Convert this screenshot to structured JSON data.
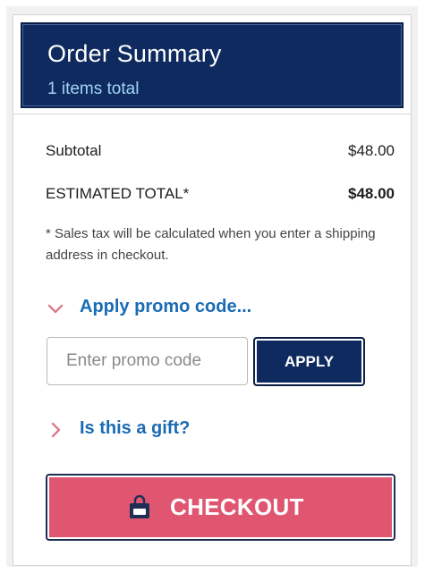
{
  "summary": {
    "title": "Order Summary",
    "items_total": "1 items total"
  },
  "lines": {
    "subtotal_label": "Subtotal",
    "subtotal_value": "$48.00",
    "estimated_total_label": "ESTIMATED TOTAL*",
    "estimated_total_value": "$48.00"
  },
  "note": "* Sales tax will be calculated when you enter a shipping address in checkout.",
  "promo": {
    "toggle_label": "Apply promo code...",
    "input_placeholder": "Enter promo code",
    "input_value": "",
    "apply_label": "APPLY"
  },
  "gift": {
    "toggle_label": "Is this a gift?"
  },
  "checkout": {
    "label": "CHECKOUT"
  },
  "icons": {
    "promo_toggle": "chevron-down-icon",
    "gift_toggle": "chevron-right-icon",
    "checkout": "shopping-bag-icon"
  },
  "colors": {
    "header_bg": "#0f2a5f",
    "header_subtitle": "#9fd4f2",
    "link": "#1a6bb5",
    "chevron": "#e07a8c",
    "checkout_bg": "#e05670",
    "apply_bg": "#0f2a5f"
  }
}
